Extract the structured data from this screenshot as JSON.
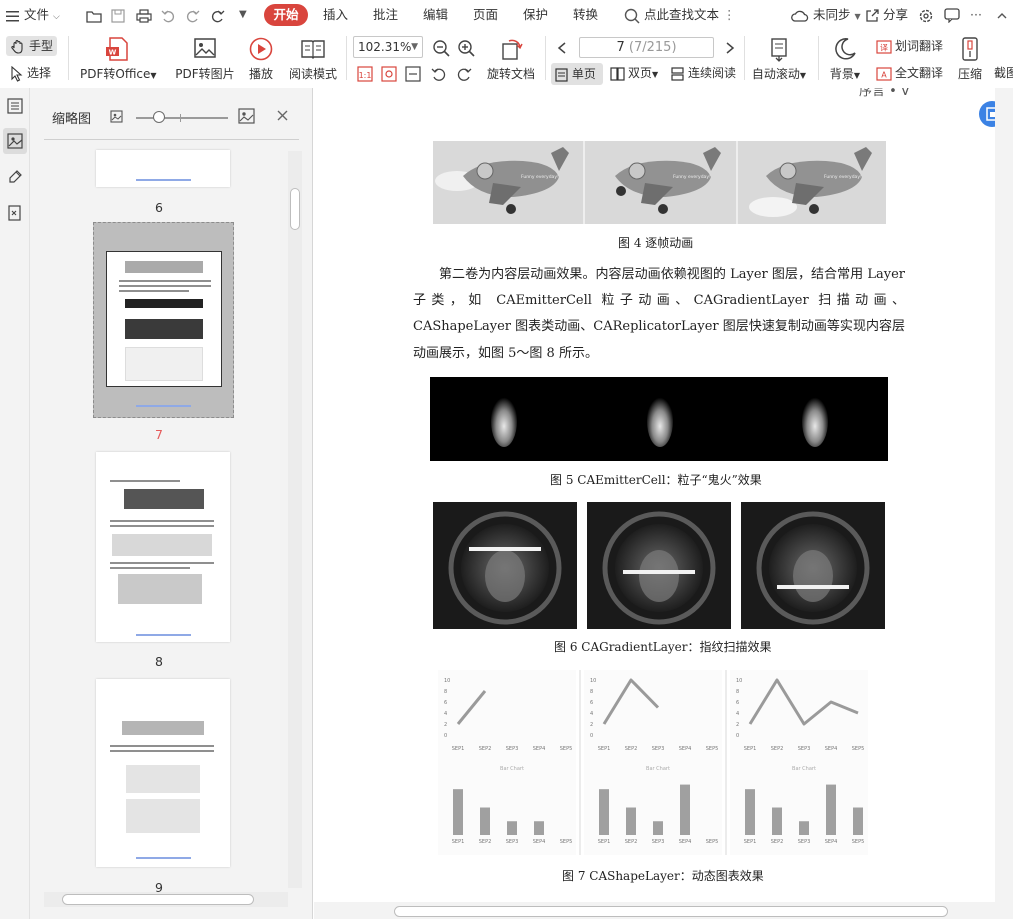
{
  "menubar": {
    "file": "文件",
    "start": "开始",
    "items": [
      "插入",
      "批注",
      "编辑",
      "页面",
      "保护",
      "转换"
    ],
    "search": "点此查找文本",
    "sync": "未同步",
    "share": "分享"
  },
  "ribbon": {
    "hand": "手型",
    "select": "选择",
    "pdf_to_office": "PDF转Office",
    "pdf_to_image": "PDF转图片",
    "play": "播放",
    "read_mode": "阅读模式",
    "zoom": "102.31%",
    "rotate": "旋转文档",
    "page_current": "7",
    "page_total": "(7/215)",
    "single": "单页",
    "double": "双页",
    "continuous": "连续阅读",
    "auto_scroll": "自动滚动",
    "background": "背景",
    "word_translate": "划词翻译",
    "full_translate": "全文翻译",
    "compress": "压缩",
    "crop": "截图"
  },
  "thumbnail_panel": {
    "title": "缩略图",
    "pages": [
      "6",
      "7",
      "8",
      "9"
    ],
    "current_page": "7"
  },
  "document": {
    "running_head": "序言 • V",
    "fig4_caption": "图 4    逐帧动画",
    "paragraph": "第二卷为内容层动画效果。内容层动画依赖视图的 Layer 图层，结合常用 Layer 子类，如 CAEmitterCell 粒子动画、CAGradientLayer 扫描动画、CAShapeLayer 图表类动画、CAReplicatorLayer 图层快速复制动画等实现内容层动画展示，如图 5～图 8 所示。",
    "fig5_caption": "图 5    CAEmitterCell：粒子“鬼火”效果",
    "fig6_caption": "图 6    CAGradientLayer：指纹扫描效果",
    "fig7_caption": "图 7    CAShapeLayer：动态图表效果",
    "plane_text": "Funny everyday!",
    "chart_panels": {
      "y_ticks": [
        "10",
        "8",
        "6",
        "4",
        "2",
        "0"
      ],
      "x_labels": [
        "SEP1",
        "SEP2",
        "SEP3",
        "SEP4",
        "SEP5"
      ],
      "caption": "Bar Chart",
      "line_series": [
        [
          2,
          8
        ],
        [
          2,
          10,
          5
        ],
        [
          2,
          10,
          2,
          6,
          4
        ]
      ],
      "bar_series": [
        [
          10,
          6,
          3,
          3
        ],
        [
          10,
          6,
          3,
          11
        ],
        [
          10,
          6,
          3,
          11,
          6
        ]
      ]
    }
  },
  "colors": {
    "accent_red": "#d9453d",
    "accent_blue": "#3b82e4",
    "current_page_red": "#e55a5a"
  }
}
